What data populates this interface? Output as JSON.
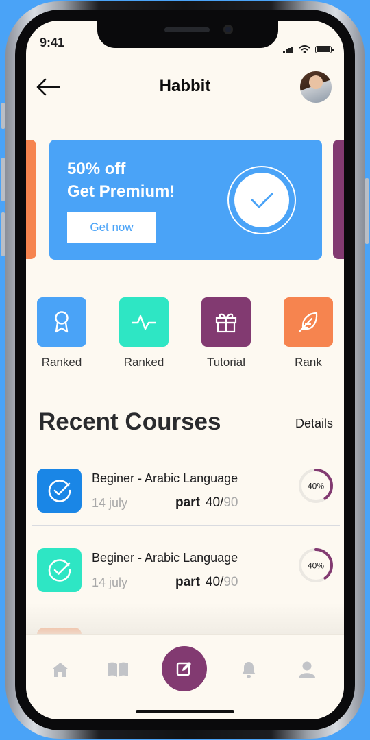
{
  "status_bar": {
    "time": "9:41"
  },
  "header": {
    "title": "Habbit"
  },
  "promo": {
    "line1": "50% off",
    "line2": "Get Premium!",
    "button_label": "Get now",
    "color": "#4aa3f7"
  },
  "side_cards": {
    "left_color": "#f6844f",
    "right_color": "#823a71"
  },
  "categories": [
    {
      "label": "Ranked",
      "icon": "award-ribbon-icon",
      "color": "#4aa3f7"
    },
    {
      "label": "Ranked",
      "icon": "activity-pulse-icon",
      "color": "#2ee6c4"
    },
    {
      "label": "Tutorial",
      "icon": "gift-icon",
      "color": "#823a71"
    },
    {
      "label": "Rank",
      "icon": "feather-icon",
      "color": "#f6844f"
    }
  ],
  "recent": {
    "title": "Recent Courses",
    "details_label": "Details",
    "courses": [
      {
        "title": "Beginer - Arabic Language",
        "date": "14 july",
        "part_label": "part",
        "part_current": "40/",
        "part_total": "90",
        "progress_label": "40%",
        "progress": 0.4,
        "color": "#1a86e6",
        "icon": "check-circle-icon"
      },
      {
        "title": "Beginer - Arabic Language",
        "date": "14 july",
        "part_label": "part",
        "part_current": "40/",
        "part_total": "90",
        "progress_label": "40%",
        "progress": 0.4,
        "color": "#2ee6c4",
        "icon": "check-circle-icon"
      }
    ]
  },
  "navbar": {
    "items": [
      "home-icon",
      "book-icon",
      "edit-icon",
      "bell-icon",
      "user-icon"
    ],
    "accent": "#823a71"
  }
}
